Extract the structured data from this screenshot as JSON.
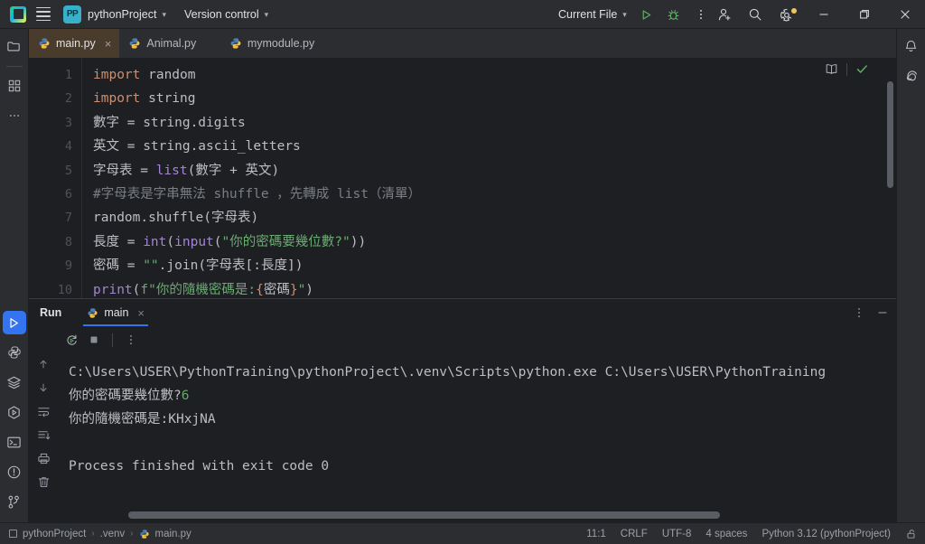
{
  "titlebar": {
    "menu_icon": "hamburger-icon",
    "project_badge": "PP",
    "project_name": "pythonProject",
    "version_control": "Version control",
    "run_config": "Current File",
    "run_icon": "run-triangle-icon",
    "debug_icon": "debug-bug-icon",
    "more_icon": "more-vertical-icon",
    "account_icon": "add-user-icon",
    "search_icon": "search-icon",
    "settings_icon": "gear-icon",
    "minimize": "minimize-icon",
    "maximize": "restore-icon",
    "close": "close-icon"
  },
  "left_stripe": {
    "items": [
      {
        "name": "project-tool-window",
        "icon": "folder-icon"
      },
      {
        "name": "structure-tool-window",
        "icon": "blocks-icon"
      },
      {
        "name": "more-tool-windows",
        "icon": "ellipsis-icon"
      }
    ],
    "bottom_items": [
      {
        "name": "run-tool-window",
        "icon": "run-triangle-icon",
        "active": true
      },
      {
        "name": "python-console",
        "icon": "python-icon"
      },
      {
        "name": "database",
        "icon": "layers-icon"
      },
      {
        "name": "services",
        "icon": "hexagon-play-icon"
      },
      {
        "name": "terminal",
        "icon": "terminal-icon"
      },
      {
        "name": "problems",
        "icon": "warning-circle-icon"
      },
      {
        "name": "version-control",
        "icon": "branch-icon"
      }
    ]
  },
  "right_stripe": {
    "items": [
      {
        "name": "notifications",
        "icon": "bell-icon"
      },
      {
        "name": "ai-assistant",
        "icon": "spiral-icon"
      }
    ]
  },
  "editor_tabs": [
    {
      "label": "main.py",
      "icon": "python-icon",
      "active": true,
      "close": "×"
    },
    {
      "label": "Animal.py",
      "icon": "python-icon",
      "active": false,
      "close": "×"
    },
    {
      "label": "mymodule.py",
      "icon": "python-icon",
      "active": false,
      "close": "×"
    }
  ],
  "editor": {
    "reader_mode_icon": "book-icon",
    "inspection_ok_icon": "green-check-icon",
    "line_numbers": [
      "1",
      "2",
      "3",
      "4",
      "5",
      "6",
      "7",
      "8",
      "9",
      "10"
    ],
    "lines": [
      [
        {
          "t": "import",
          "c": "kw"
        },
        {
          "t": " random",
          "c": "plain"
        }
      ],
      [
        {
          "t": "import",
          "c": "kw"
        },
        {
          "t": " string",
          "c": "plain"
        }
      ],
      [
        {
          "t": "數字 = string.digits",
          "c": "plain"
        }
      ],
      [
        {
          "t": "英文 = string.ascii_letters",
          "c": "plain"
        }
      ],
      [
        {
          "t": "字母表 = ",
          "c": "plain"
        },
        {
          "t": "list",
          "c": "fn"
        },
        {
          "t": "(數字 + 英文)",
          "c": "plain"
        }
      ],
      [
        {
          "t": "#字母表是字串無法 shuffle ，先轉成 list（清單）",
          "c": "cmt"
        }
      ],
      [
        {
          "t": "random.shuffle(字母表)",
          "c": "plain"
        }
      ],
      [
        {
          "t": "長度 = ",
          "c": "plain"
        },
        {
          "t": "int",
          "c": "fn"
        },
        {
          "t": "(",
          "c": "plain"
        },
        {
          "t": "input",
          "c": "fn"
        },
        {
          "t": "(",
          "c": "plain"
        },
        {
          "t": "\"你的密碼要幾位數?\"",
          "c": "str"
        },
        {
          "t": "))",
          "c": "plain"
        }
      ],
      [
        {
          "t": "密碼 = ",
          "c": "plain"
        },
        {
          "t": "\"\"",
          "c": "str"
        },
        {
          "t": ".join(字母表[:長度])",
          "c": "plain"
        }
      ],
      [
        {
          "t": "print",
          "c": "fn"
        },
        {
          "t": "(",
          "c": "plain"
        },
        {
          "t": "f\"你的隨機密碼是:",
          "c": "str"
        },
        {
          "t": "{",
          "c": "brace"
        },
        {
          "t": "密碼",
          "c": "plain"
        },
        {
          "t": "}",
          "c": "brace"
        },
        {
          "t": "\"",
          "c": "str"
        },
        {
          "t": ")",
          "c": "plain"
        }
      ]
    ]
  },
  "run_panel": {
    "title": "Run",
    "tab_label": "main",
    "tab_icon": "python-icon",
    "tab_close": "×",
    "options_icon": "more-vertical-icon",
    "minimize_icon": "minimize-icon",
    "toolbar": [
      {
        "name": "rerun-button",
        "icon": "rerun-icon"
      },
      {
        "name": "stop-button",
        "icon": "stop-square-icon"
      },
      {
        "name": "run-more-button",
        "icon": "more-vertical-icon"
      }
    ],
    "side_tools": [
      {
        "name": "scroll-up-button",
        "icon": "arrow-up-icon"
      },
      {
        "name": "scroll-down-button",
        "icon": "arrow-down-icon"
      },
      {
        "name": "soft-wrap-button",
        "icon": "wrap-icon"
      },
      {
        "name": "scroll-to-end-button",
        "icon": "scroll-end-icon"
      },
      {
        "name": "print-button",
        "icon": "printer-icon"
      },
      {
        "name": "clear-all-button",
        "icon": "trash-icon"
      }
    ],
    "console_lines": [
      {
        "segments": [
          {
            "t": "C:\\Users\\USER\\PythonTraining\\pythonProject\\.venv\\Scripts\\python.exe C:\\Users\\USER\\PythonTraining",
            "c": "plain"
          }
        ]
      },
      {
        "segments": [
          {
            "t": "你的密碼要幾位數?",
            "c": "plain"
          },
          {
            "t": "6",
            "c": "co-in"
          }
        ]
      },
      {
        "segments": [
          {
            "t": "你的隨機密碼是:KHxjNA",
            "c": "plain"
          }
        ]
      },
      {
        "segments": [
          {
            "t": " ",
            "c": "plain"
          }
        ]
      },
      {
        "segments": [
          {
            "t": "Process finished with exit code 0",
            "c": "plain"
          }
        ]
      }
    ]
  },
  "statusbar": {
    "breadcrumb": [
      {
        "label": "pythonProject",
        "icon": "project-square-icon"
      },
      {
        "label": ".venv",
        "icon": ""
      },
      {
        "label": "main.py",
        "icon": "python-icon"
      }
    ],
    "separator": "›",
    "caret_position": "11:1",
    "line_separator": "CRLF",
    "encoding": "UTF-8",
    "indent": "4 spaces",
    "interpreter": "Python 3.12 (pythonProject)",
    "lock_icon": "unlocked-icon"
  },
  "colors": {
    "accent_blue": "#3574f0",
    "tab_active_bg": "#4a3c2c",
    "keyword": "#cf8e6d",
    "function": "#a385d4",
    "string": "#6aab73",
    "comment": "#7a7e85",
    "console_input": "#5fad65",
    "bg": "#1e1f22",
    "chrome": "#2b2d30"
  }
}
